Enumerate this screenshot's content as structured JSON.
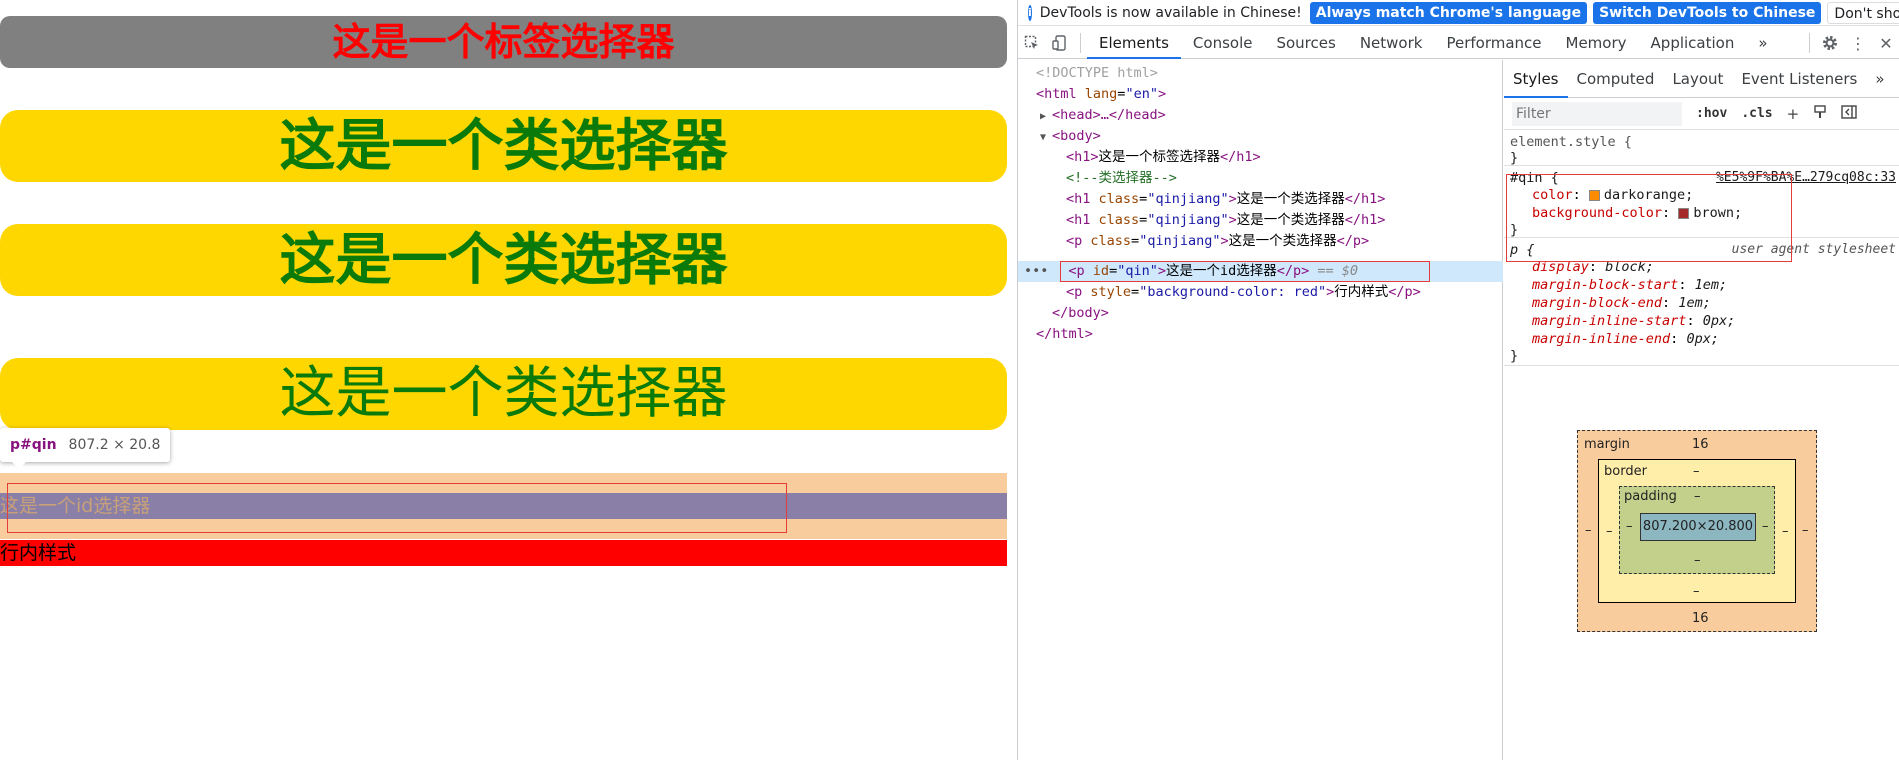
{
  "page": {
    "h1_tag": "这是一个标签选择器",
    "h1_class_1": "这是一个类选择器",
    "h1_class_2": "这是一个类选择器",
    "p_class": "这是一个类选择器",
    "p_id": "这是一个id选择器",
    "p_inline": "行内样式",
    "tooltip": {
      "tag": "p#qin",
      "size": "807.2 × 20.8"
    }
  },
  "infobar": {
    "message": "DevTools is now available in Chinese!",
    "btn_match": "Always match Chrome's language",
    "btn_switch": "Switch DevTools to Chinese",
    "btn_dismiss": "Don't show again",
    "close": "×"
  },
  "toolbar": {
    "tabs": [
      "Elements",
      "Console",
      "Sources",
      "Network",
      "Performance",
      "Memory",
      "Application"
    ],
    "more": "»"
  },
  "elements": {
    "doctype": "<!DOCTYPE html>",
    "html_open_tag": "<html",
    "html_lang_attr": "lang",
    "html_lang_val": "\"en\"",
    "html_open_end": ">",
    "head": "<head>…</head>",
    "body_open": "<body>",
    "line_h1": {
      "open": "<h1>",
      "text": "这是一个标签选择器",
      "close": "</h1>"
    },
    "comment": "<!--类选择器-->",
    "line_h1_class_1": {
      "open": "<h1",
      "attr": "class",
      "val": "\"qinjiang\"",
      "gt": ">",
      "text": "这是一个类选择器",
      "close": "</h1>"
    },
    "line_h1_class_2": {
      "open": "<h1",
      "attr": "class",
      "val": "\"qinjiang\"",
      "gt": ">",
      "text": "这是一个类选择器",
      "close": "</h1>"
    },
    "line_p_class": {
      "open": "<p",
      "attr": "class",
      "val": "\"qinjiang\"",
      "gt": ">",
      "text": "这是一个类选择器",
      "close": "</p>"
    },
    "line_p_id": {
      "dots": "•••",
      "open": "<p",
      "attr": "id",
      "val": "\"qin\"",
      "gt": ">",
      "text": "这是一个id选择器",
      "close": "</p>",
      "eq": "== $0"
    },
    "line_p_style": {
      "open": "<p",
      "attr": "style",
      "val": "\"background-color: red\"",
      "gt": ">",
      "text": "行内样式",
      "close": "</p>"
    },
    "body_close": "</body>",
    "html_close": "</html>"
  },
  "styles": {
    "subtabs": [
      "Styles",
      "Computed",
      "Layout",
      "Event Listeners"
    ],
    "subtabs_more": "»",
    "filter_placeholder": "Filter",
    "hov": ":hov",
    "cls": ".cls",
    "plus": "+",
    "element_style_selector": "element.style {",
    "close_brace": "}",
    "qin_rule": {
      "selector": "#qin {",
      "source": "%E5%9F%BA%E…279cq08c:33",
      "decls": [
        {
          "name": "color",
          "value": "darkorange;",
          "swatch": "#ff8c00"
        },
        {
          "name": "background-color",
          "value": "brown;",
          "swatch": "#a52a2a"
        }
      ]
    },
    "ua_rule": {
      "selector": "p {",
      "source": "user agent stylesheet",
      "decls": [
        {
          "name": "display",
          "value": "block;"
        },
        {
          "name": "margin-block-start",
          "value": "1em;"
        },
        {
          "name": "margin-block-end",
          "value": "1em;"
        },
        {
          "name": "margin-inline-start",
          "value": "0px;"
        },
        {
          "name": "margin-inline-end",
          "value": "0px;"
        }
      ]
    },
    "boxmodel": {
      "margin_label": "margin",
      "margin_top": "16",
      "margin_bottom": "16",
      "margin_left": "–",
      "margin_right": "–",
      "border_label": "border",
      "border_top": "–",
      "border_bottom": "–",
      "border_left": "–",
      "border_right": "–",
      "padding_label": "padding",
      "padding_top": "–",
      "padding_bottom": "–",
      "padding_left": "–",
      "padding_right": "–",
      "content": "807.200×20.800"
    }
  },
  "colors": {
    "accent": "#1a73e8",
    "tag_color": "#881280",
    "attr_name": "#994500",
    "attr_value": "#1a1aa6"
  }
}
